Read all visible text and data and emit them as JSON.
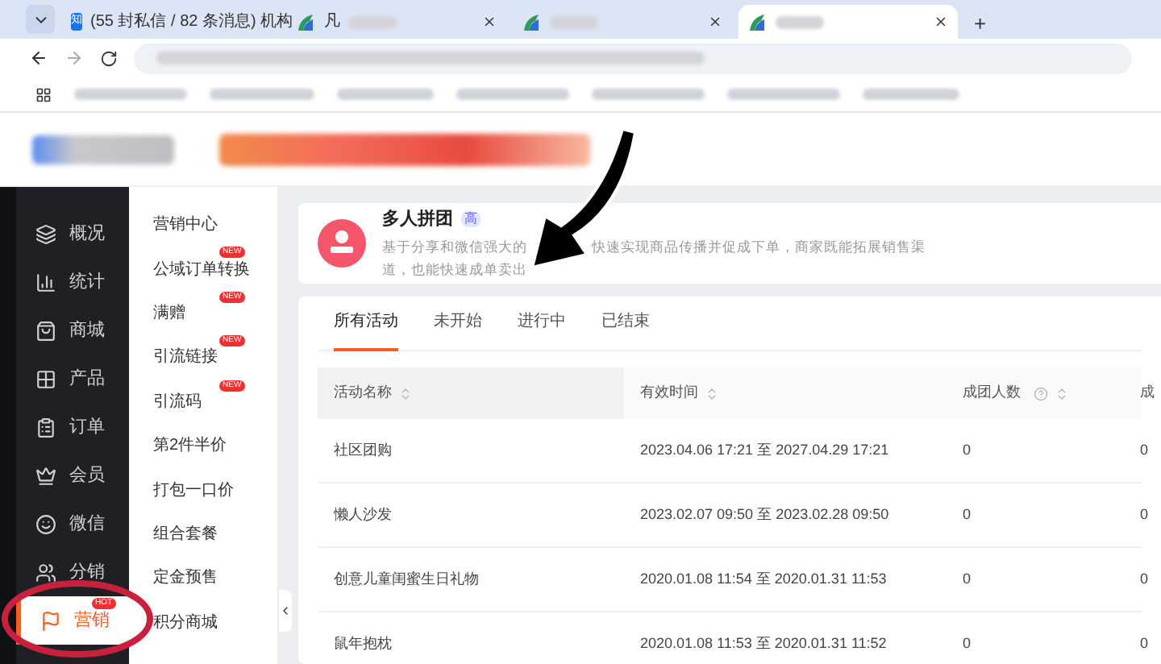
{
  "browser": {
    "tabs": [
      {
        "title": "(55 封私信 / 82 条消息) 机构",
        "selected": false,
        "kind": "zhihu",
        "logo": "知"
      },
      {
        "title": "凡",
        "selected": false,
        "kind": "site"
      },
      {
        "selected": false,
        "kind": "site"
      },
      {
        "selected": true,
        "kind": "site"
      }
    ],
    "new_tab": "+"
  },
  "sidebar": {
    "items": [
      {
        "label": "概况",
        "selected": false
      },
      {
        "label": "统计",
        "selected": false
      },
      {
        "label": "商城",
        "selected": false
      },
      {
        "label": "产品",
        "selected": false
      },
      {
        "label": "订单",
        "selected": false
      },
      {
        "label": "会员",
        "selected": false
      },
      {
        "label": "微信",
        "selected": false
      },
      {
        "label": "分销",
        "selected": false
      },
      {
        "label": "营销",
        "selected": true,
        "badge": "HOT"
      }
    ]
  },
  "submenu": {
    "items": [
      {
        "label": "营销中心"
      },
      {
        "label": "公域订单转换",
        "badge": "NEW"
      },
      {
        "label": "满赠",
        "badge": "NEW"
      },
      {
        "label": "引流链接",
        "badge": "NEW"
      },
      {
        "label": "引流码",
        "badge": "NEW"
      },
      {
        "label": "第2件半价"
      },
      {
        "label": "打包一口价"
      },
      {
        "label": "组合套餐"
      },
      {
        "label": "定金预售"
      },
      {
        "label": "积分商城"
      }
    ]
  },
  "promo": {
    "title": "多人拼团",
    "badge": "高",
    "description_line1_start": "基于分享和微信强大的",
    "description_line1_end": "快速实现商品传播并促成下单，商家既能拓展销售渠",
    "description_line2": "道，也能快速成单卖出"
  },
  "activity_tabs": [
    {
      "label": "所有活动",
      "selected": true
    },
    {
      "label": "未开始",
      "selected": false
    },
    {
      "label": "进行中",
      "selected": false
    },
    {
      "label": "已结束",
      "selected": false
    }
  ],
  "table": {
    "columns": [
      {
        "label": "活动名称",
        "sortable": true,
        "help": false
      },
      {
        "label": "有效时间",
        "sortable": true,
        "help": false
      },
      {
        "label": "成团人数",
        "sortable": true,
        "help": true
      },
      {
        "label": "成"
      }
    ],
    "rows": [
      [
        "社区团购",
        "2023.04.06 17:21 至 2027.04.29 17:21",
        "0",
        "0"
      ],
      [
        "懒人沙发",
        "2023.02.07 09:50 至 2023.02.28 09:50",
        "0",
        "0"
      ],
      [
        "创意儿童闺蜜生日礼物",
        "2020.01.08 11:54 至 2020.01.31 11:53",
        "0",
        "0"
      ],
      [
        "鼠年抱枕",
        "2020.01.08 11:53 至 2020.01.31 11:52",
        "0",
        "0"
      ]
    ]
  }
}
